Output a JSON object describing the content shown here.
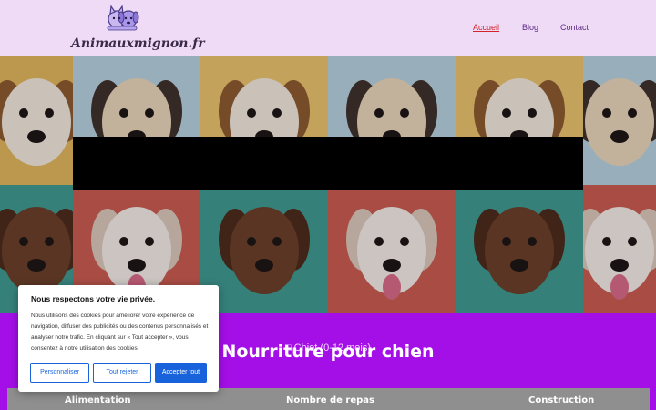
{
  "site": {
    "logo_text": "Animauxmignon.fr",
    "logo_icon": "cat-and-dog-logo"
  },
  "nav": {
    "items": [
      {
        "label": "Accueil",
        "active": true
      },
      {
        "label": "Blog",
        "active": false
      },
      {
        "label": "Contact",
        "active": false
      }
    ]
  },
  "hero": {
    "image": "dog-portrait-mosaic",
    "tiles_row_1": [
      "beagle-puppy",
      "pug",
      "beagle-puppy",
      "pug",
      "beagle-puppy",
      "pug"
    ],
    "tiles_row_2": [
      "brown-puppy",
      "bulldog",
      "brown-puppy",
      "bulldog",
      "brown-puppy",
      "bulldog"
    ]
  },
  "section": {
    "subtitle": "Chiot (0-12 mois)",
    "subtitle_icon": "box-icon",
    "title": "Nourriture pour chien",
    "table_headers": [
      "Alimentation",
      "Nombre de repas",
      "Construction"
    ]
  },
  "cookie": {
    "title": "Nous respectons votre vie privée.",
    "text": "Nous utilisons des cookies pour améliorer votre expérience de navigation, diffuser des publicités ou des contenus personnalisés et analyser notre trafic. En cliquant sur « Tout accepter », vous consentez à notre utilisation des cookies.",
    "customize_label": "Personnaliser",
    "reject_label": "Tout rejeter",
    "accept_label": "Accepter tout"
  },
  "colors": {
    "header_bg": "#efdbf6",
    "section_bg": "#a40fe8",
    "table_header_bg": "#8f8f8f",
    "nav_active": "#d3232a",
    "button_primary": "#1863dc"
  }
}
